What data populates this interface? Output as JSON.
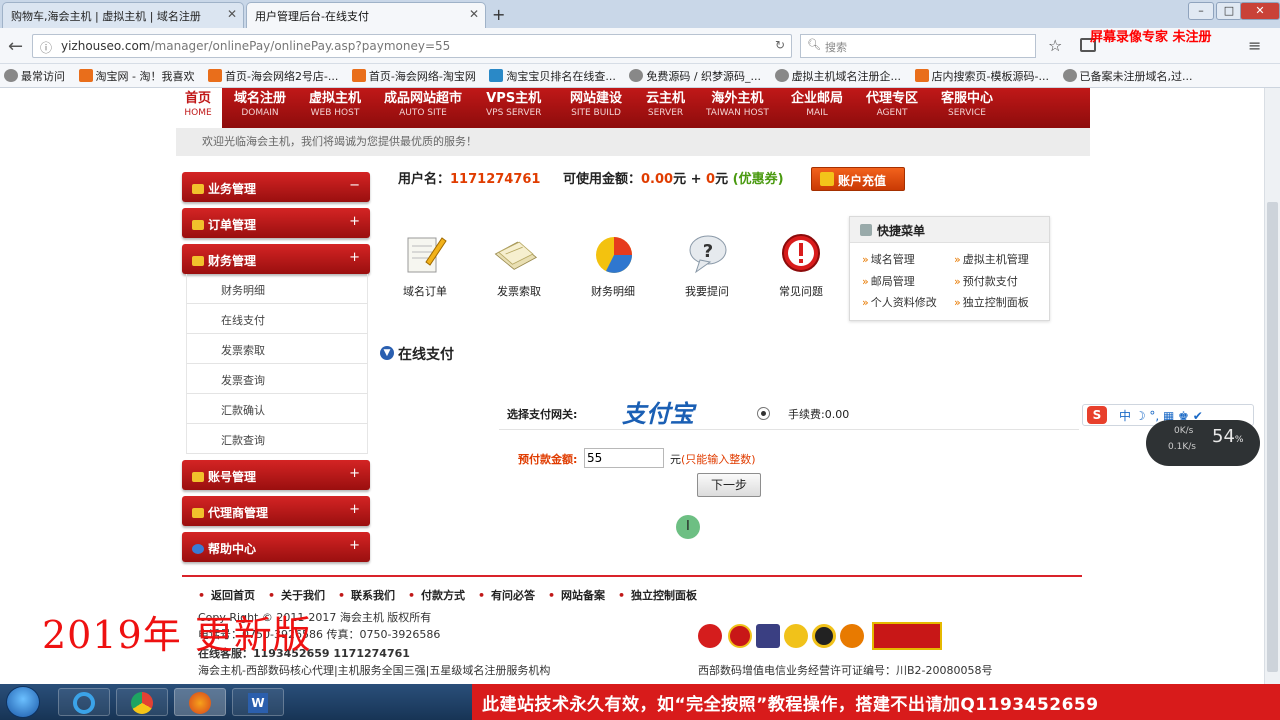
{
  "browser": {
    "tabs": [
      {
        "label": "购物车,海会主机 | 虚拟主机 | 域名注册"
      },
      {
        "label": "用户管理后台-在线支付"
      }
    ],
    "url_host": "yizhouseo.com",
    "url_path": "/manager/onlinePay/onlinePay.asp?paymoney=55",
    "search_placeholder": "搜索",
    "bookmarks": [
      "最常访问",
      "淘宝网 - 淘！我喜欢",
      "首页-海会网络2号店-...",
      "首页-海会网络-淘宝网",
      "淘宝宝贝排名在线查...",
      "免费源码 / 织梦源码_...",
      "虚拟主机域名注册企...",
      "店内搜索页-模板源码-...",
      "已备案未注册域名,过..."
    ]
  },
  "site_nav": [
    {
      "cn": "首页",
      "en": "HOME"
    },
    {
      "cn": "域名注册",
      "en": "DOMAIN"
    },
    {
      "cn": "虚拟主机",
      "en": "WEB HOST"
    },
    {
      "cn": "成品网站超市",
      "en": "AUTO SITE"
    },
    {
      "cn": "VPS主机",
      "en": "VPS SERVER"
    },
    {
      "cn": "网站建设",
      "en": "SITE BUILD"
    },
    {
      "cn": "云主机",
      "en": "SERVER"
    },
    {
      "cn": "海外主机",
      "en": "TAIWAN HOST"
    },
    {
      "cn": "企业邮局",
      "en": "MAIL"
    },
    {
      "cn": "代理专区",
      "en": "AGENT"
    },
    {
      "cn": "客服中心",
      "en": "SERVICE"
    }
  ],
  "welcome": "欢迎光临海会主机，我们将竭诚为您提供最优质的服务！",
  "sidebar": {
    "sections": [
      {
        "label": "业务管理",
        "toggle": "−"
      },
      {
        "label": "订单管理",
        "toggle": "+"
      },
      {
        "label": "财务管理",
        "toggle": "+"
      },
      {
        "label": "账号管理",
        "toggle": "+"
      },
      {
        "label": "代理商管理",
        "toggle": "+"
      },
      {
        "label": "帮助中心",
        "toggle": "+"
      }
    ],
    "finance_items": [
      "财务明细",
      "在线支付",
      "发票索取",
      "发票查询",
      "汇款确认",
      "汇款查询"
    ]
  },
  "account": {
    "username_label": "用户名：",
    "username": "1171274761",
    "balance_label": "可使用金额：",
    "balance": "0.00",
    "yuan": "元 +",
    "coupon_value": "0",
    "coupon_unit": "元",
    "coupon_label": "(优惠券)",
    "recharge_button": "账户充值"
  },
  "quick_icons": [
    {
      "label": "域名订单",
      "icon": "pencil-note-icon"
    },
    {
      "label": "发票索取",
      "icon": "invoice-stack-icon"
    },
    {
      "label": "财务明细",
      "icon": "pie-chart-icon"
    },
    {
      "label": "我要提问",
      "icon": "question-bubble-icon"
    },
    {
      "label": "常见问题",
      "icon": "warning-icon"
    }
  ],
  "quick_menu": {
    "title": "快捷菜单",
    "items": [
      "域名管理",
      "虚拟主机管理",
      "邮局管理",
      "预付款支付",
      "个人资料修改",
      "独立控制面板"
    ]
  },
  "payment": {
    "title": "在线支付",
    "gateway_label": "选择支付网关:",
    "gateway_logo": "支付宝",
    "fee": "手续费:0.00",
    "amount_label": "预付款金额:",
    "amount_value": "55",
    "amount_unit": "元",
    "amount_hint": "(只能输入整数)",
    "next_button": "下一步"
  },
  "footer": {
    "links": [
      "返回首页",
      "关于我们",
      "联系我们",
      "付款方式",
      "有问必答",
      "网站备案",
      "独立控制面板"
    ],
    "copyright": "Copy Right © 2011-2017 海会主机 版权所有",
    "phone": "电话号：0750-3926586   传真：0750-3926586",
    "service": "在线客服：1193452659   1171274761",
    "tagline": "海会主机-西部数码核心代理|主机服务全国三强|五星级域名注册服务机构",
    "license": "西部数码增值电信业务经营许可证编号：川B2-20080058号"
  },
  "overlays": {
    "record_watermark": "屏幕录像专家 未注册",
    "year_watermark": "2019年 更新版",
    "ime_bar": "中 ☽ °, ▦ ♚ ✔",
    "net_up": "0K/s",
    "net_down": "0.1K/s",
    "net_pct": "54",
    "banner": "此建站技术永久有效，如“完全按照”教程操作，搭建不出请加Q1193452659"
  },
  "colors": {
    "brand_red": "#c01818",
    "accent_orange": "#e03c00"
  }
}
